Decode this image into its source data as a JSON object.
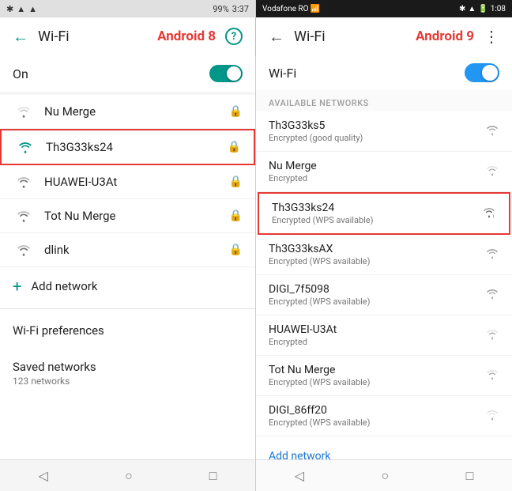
{
  "a8": {
    "status_bar": {
      "bluetooth": "✱",
      "signal": "▲",
      "battery": "99%",
      "time": "3:37"
    },
    "header": {
      "title": "Wi-Fi",
      "android_label": "Android 8",
      "help": "?"
    },
    "wifi_toggle": {
      "label": "On"
    },
    "networks": [
      {
        "name": "Nu Merge",
        "selected": false,
        "icon_strength": 3
      },
      {
        "name": "Th3G33ks24",
        "selected": true,
        "icon_strength": 4
      },
      {
        "name": "HUAWEI-U3At",
        "selected": false,
        "icon_strength": 2
      },
      {
        "name": "Tot Nu Merge",
        "selected": false,
        "icon_strength": 2
      },
      {
        "name": "dlink",
        "selected": false,
        "icon_strength": 2
      }
    ],
    "add_network": "Add network",
    "menu_items": [
      {
        "label": "Wi-Fi preferences"
      },
      {
        "label": "Saved networks",
        "sub": "123 networks"
      }
    ],
    "nav": {
      "back": "◁",
      "home": "○",
      "recents": "□"
    }
  },
  "a9": {
    "status_bar": {
      "carrier": "Vodafone RO",
      "signal_icons": "🔵 ✱ ▲ ▲ 🔋 1:08"
    },
    "header": {
      "title": "Wi-Fi",
      "android_label": "Android 9",
      "more": "⋮"
    },
    "wifi_toggle": {
      "label": "Wi-Fi"
    },
    "section_header": "AVAILABLE NETWORKS",
    "networks": [
      {
        "name": "Th3G33ks5",
        "status": "Encrypted (good quality)",
        "selected": false,
        "strength": 4
      },
      {
        "name": "Nu Merge",
        "status": "Encrypted",
        "selected": false,
        "strength": 3
      },
      {
        "name": "Th3G33ks24",
        "status": "Encrypted (WPS available)",
        "selected": true,
        "strength": 4
      },
      {
        "name": "Th3G33ksAX",
        "status": "Encrypted (WPS available)",
        "selected": false,
        "strength": 4
      },
      {
        "name": "DIGI_7f5098",
        "status": "Encrypted (WPS available)",
        "selected": false,
        "strength": 4
      },
      {
        "name": "HUAWEI-U3At",
        "status": "Encrypted",
        "selected": false,
        "strength": 3
      },
      {
        "name": "Tot Nu Merge",
        "status": "Encrypted (WPS available)",
        "selected": false,
        "strength": 3
      },
      {
        "name": "DIGI_86ff20",
        "status": "Encrypted (WPS available)",
        "selected": false,
        "strength": 3
      }
    ],
    "add_network": "Add network",
    "nav": {
      "back": "◁",
      "home": "○",
      "recents": "□"
    }
  }
}
